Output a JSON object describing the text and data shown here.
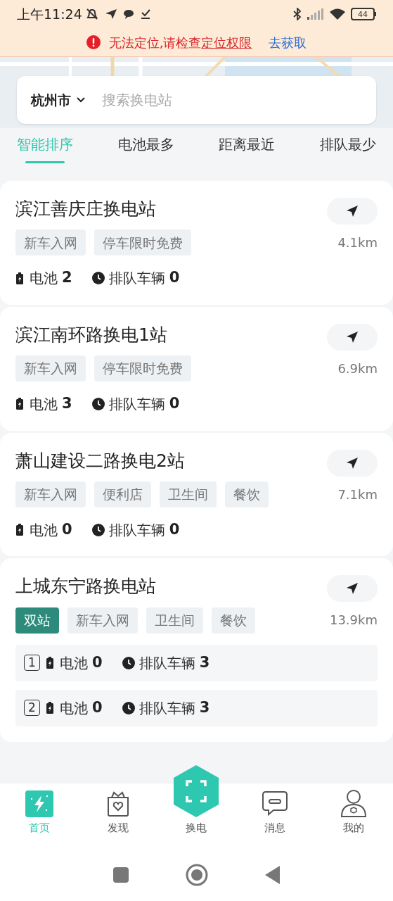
{
  "status_bar": {
    "time": "上午11:24",
    "battery": "44"
  },
  "location_warning": {
    "text": "无法定位,请检查",
    "link": "定位权限",
    "action": "去获取"
  },
  "search": {
    "city": "杭州市",
    "placeholder": "搜索换电站"
  },
  "sort_tabs": [
    {
      "label": "智能排序",
      "selected": true
    },
    {
      "label": "电池最多",
      "selected": false
    },
    {
      "label": "距离最近",
      "selected": false
    },
    {
      "label": "排队最少",
      "selected": false
    }
  ],
  "stations": [
    {
      "name": "滨江善庆庄换电站",
      "distance": "4.1km",
      "tags": [
        {
          "label": "新车入网",
          "highlight": false
        },
        {
          "label": "停车限时免费",
          "highlight": false
        }
      ],
      "units": [
        {
          "battery_label": "电池",
          "battery": "2",
          "queue_label": "排队车辆",
          "queue": "0"
        }
      ]
    },
    {
      "name": "滨江南环路换电1站",
      "distance": "6.9km",
      "tags": [
        {
          "label": "新车入网",
          "highlight": false
        },
        {
          "label": "停车限时免费",
          "highlight": false
        }
      ],
      "units": [
        {
          "battery_label": "电池",
          "battery": "3",
          "queue_label": "排队车辆",
          "queue": "0"
        }
      ]
    },
    {
      "name": "萧山建设二路换电2站",
      "distance": "7.1km",
      "tags": [
        {
          "label": "新车入网",
          "highlight": false
        },
        {
          "label": "便利店",
          "highlight": false
        },
        {
          "label": "卫生间",
          "highlight": false
        },
        {
          "label": "餐饮",
          "highlight": false
        }
      ],
      "units": [
        {
          "battery_label": "电池",
          "battery": "0",
          "queue_label": "排队车辆",
          "queue": "0"
        }
      ]
    },
    {
      "name": "上城东宁路换电站",
      "distance": "13.9km",
      "tags": [
        {
          "label": "双站",
          "highlight": true
        },
        {
          "label": "新车入网",
          "highlight": false
        },
        {
          "label": "卫生间",
          "highlight": false
        },
        {
          "label": "餐饮",
          "highlight": false
        }
      ],
      "units": [
        {
          "index": "1",
          "battery_label": "电池",
          "battery": "0",
          "queue_label": "排队车辆",
          "queue": "3"
        },
        {
          "index": "2",
          "battery_label": "电池",
          "battery": "0",
          "queue_label": "排队车辆",
          "queue": "3"
        }
      ]
    }
  ],
  "bottom_nav": [
    {
      "label": "首页",
      "kind": "home",
      "selected": true
    },
    {
      "label": "发现",
      "kind": "discover",
      "selected": false
    },
    {
      "label": "换电",
      "kind": "swap",
      "selected": false
    },
    {
      "label": "消息",
      "kind": "message",
      "selected": false
    },
    {
      "label": "我的",
      "kind": "profile",
      "selected": false
    }
  ]
}
